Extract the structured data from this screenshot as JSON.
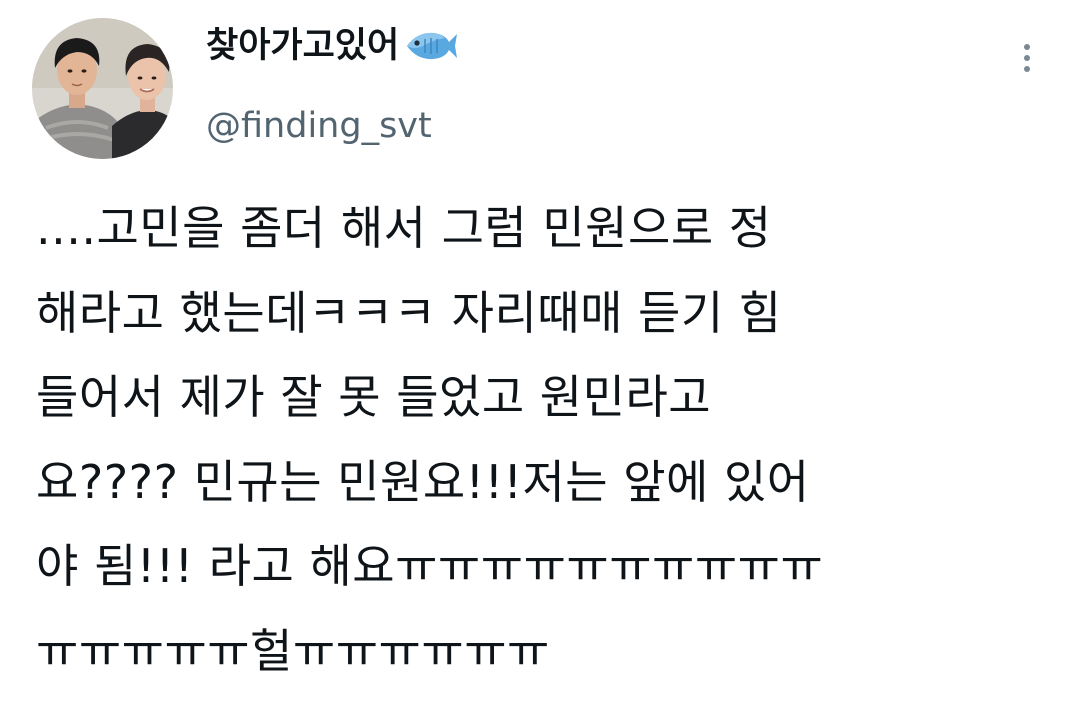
{
  "tweet": {
    "author": {
      "display_name": "찾아가고있어",
      "display_name_emoji": "fish-icon",
      "handle": "@finding_svt",
      "avatar": "profile-photo"
    },
    "more_icon": "more-vertical-icon",
    "text_lines": [
      "....고민을 좀더 해서 그럼 민원으로 정",
      "해라고 했는데ㅋㅋㅋ 자리때매 듣기 힘",
      "들어서 제가 잘 못 들었고 원민라고",
      "요???? 민규는 민원요!!!저는 앞에 있어",
      "야 됨!!! 라고 해요ㅠㅠㅠㅠㅠㅠㅠㅠㅠㅠ",
      "ㅠㅠㅠㅠㅠ헐ㅠㅠㅠㅠㅠㅠ"
    ],
    "colors": {
      "text": "#0f1419",
      "secondary_text": "#536471",
      "icon": "#7a8893",
      "background": "#ffffff",
      "fish": "#5aa8e0"
    }
  }
}
